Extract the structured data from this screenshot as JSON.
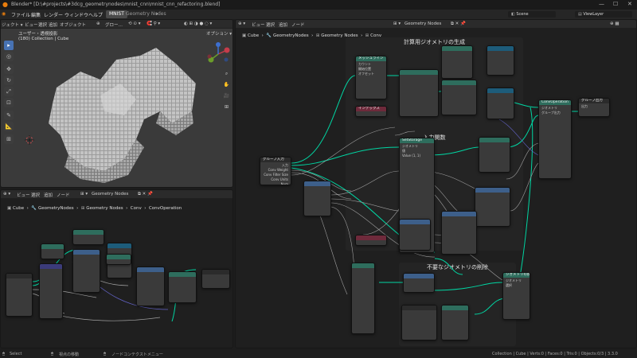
{
  "window": {
    "title": "Blender* [D:\\#projects\\#3dcg_geometrynodes\\mnist_cnn\\mnist_cnn_refactoring.blend]"
  },
  "menu": {
    "items": [
      "ファイル",
      "編集",
      "レンダー",
      "ウィンドウ",
      "ヘルプ"
    ],
    "workspace_tabs": [
      "MNIST",
      "Geometry Nodes"
    ],
    "scene": "Scene",
    "view_layer": "ViewLayer"
  },
  "viewport": {
    "menu": [
      "ジェクト ▾",
      "ビュー",
      "選択",
      "追加",
      "オブジェクト"
    ],
    "mode": "グロー…",
    "options": "オプション ▾",
    "info_line1": "ユーザー・透視投影",
    "info_line2": "(180) Collection | Cube"
  },
  "bottom_left_editor": {
    "menu": [
      "ビュー",
      "選択",
      "追加",
      "ノード"
    ],
    "tree_name": "Geometry Nodes",
    "breadcrumb": [
      "Cube",
      "GeometryNodes",
      "Geometry Nodes",
      "Conv",
      "ConvOperation"
    ]
  },
  "node_editor": {
    "menu": [
      "ビュー",
      "選択",
      "追加",
      "ノード"
    ],
    "tree_name": "Geometry Nodes",
    "breadcrumb": [
      "Cube",
      "GeometryNodes",
      "Geometry Nodes",
      "Conv"
    ],
    "frames": [
      {
        "label": "計算用ジオメトリの生成"
      },
      {
        "label": "入力関数"
      },
      {
        "label": "不要なジオメトリの削除"
      }
    ],
    "nodes": {
      "group_input": {
        "title": "グループ入力",
        "sockets": [
          "入力",
          "Conv Weight",
          "Conv Filter Size",
          "Conv Units Num"
        ]
      },
      "group_output": {
        "title": "グループ出力",
        "sockets": [
          "ジオメトリ",
          "出力"
        ]
      },
      "conv_operation": {
        "title": "ConvOperation",
        "sockets": [
          "ジオメトリ",
          "グループ出力"
        ]
      },
      "sample_index": {
        "title": "SetStorage",
        "sockets": [
          "ジオメトリ",
          "値",
          "Value (1, 1)",
          "Value (1, 2) * Radius"
        ]
      },
      "store_attr": {
        "title": "インデックス",
        "sockets": [
          "インデックス"
        ]
      },
      "delete_geom": {
        "title": "ジオメトリの削除",
        "sockets": [
          "ジオメトリ",
          "選択"
        ]
      },
      "mesh_line": {
        "title": "メッシュライン",
        "sockets": [
          "カウント",
          "開始位置",
          "オフセット"
        ]
      }
    }
  },
  "status": {
    "left": "Select",
    "middle": "視点の移動",
    "right_menu": "ノードコンテクストメニュー",
    "stats": "Collection | Cube | Verts:0 | Faces:0 | Tris:0 | Objects:0/3 | 3.3.0"
  },
  "colors": {
    "geometry_node_header": "#2e6d5d",
    "input_node_header": "#3b3b7a",
    "group_node_header": "#1d5c7a",
    "math_node_header": "#3d5f8a",
    "attribute_header": "#6e2a3b",
    "link_geometry": "#00d6a3",
    "link_float": "#a1a1a1",
    "link_vector": "#6363c7"
  }
}
